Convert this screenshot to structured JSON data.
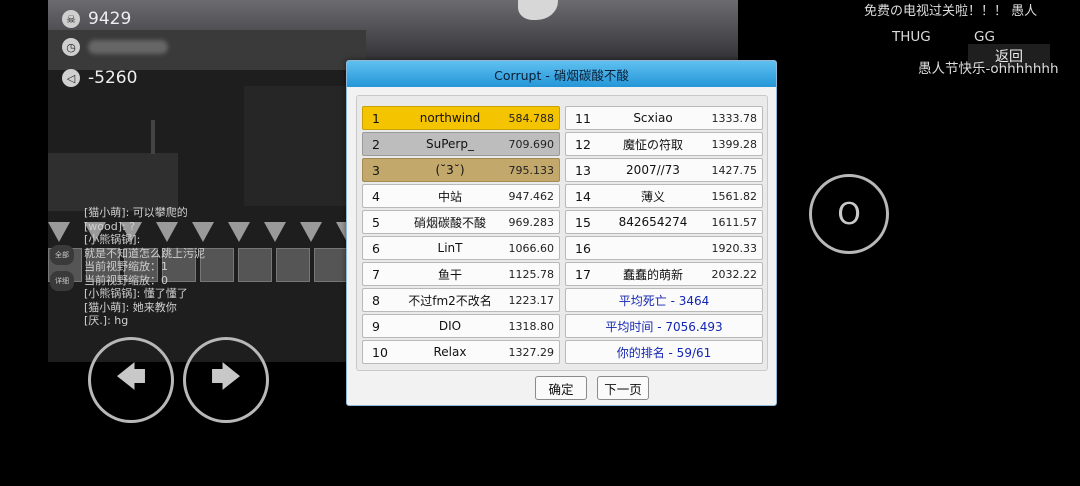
{
  "hud": {
    "deaths": "9429",
    "deaths_icon": "skull-icon",
    "time_icon": "clock-icon",
    "coords": "-5260",
    "coords_icon": "flag-icon"
  },
  "chat": [
    "[猫小萌]: 可以攀爬的",
    "[wood]: ?",
    "[小熊锅锅]:",
    "就是不知道怎么跳上污泥",
    "当前视野缩放：1",
    "当前视野缩放：0",
    "[小熊锅锅]: 懂了懂了",
    "[猫小萌]: 她来教你",
    "[厌.]: hg"
  ],
  "side_tags": {
    "all": "全部",
    "detail": "详细"
  },
  "controls": {
    "jump_label": "O",
    "left_icon": "arrow-left-icon",
    "right_icon": "arrow-right-icon"
  },
  "top_right": {
    "marquee": "免费の电视过关啦！！！       愚人",
    "player1": "THUG",
    "player2": "GG",
    "back_label": "返回",
    "announcement": "愚人节快乐-ohhhhhhh"
  },
  "dialog": {
    "title": "Corrupt - 硝烟碳酸不酸",
    "left_col": [
      {
        "rank": "1",
        "name": "northwind",
        "time": "584.788"
      },
      {
        "rank": "2",
        "name": "SuPerp_",
        "time": "709.690"
      },
      {
        "rank": "3",
        "name": "(˘3˘)",
        "time": "795.133"
      },
      {
        "rank": "4",
        "name": "中站",
        "time": "947.462"
      },
      {
        "rank": "5",
        "name": "硝烟碳酸不酸",
        "time": "969.283"
      },
      {
        "rank": "6",
        "name": "LinT",
        "time": "1066.60"
      },
      {
        "rank": "7",
        "name": "鱼干",
        "time": "1125.78"
      },
      {
        "rank": "8",
        "name": "不过fm2不改名",
        "time": "1223.17"
      },
      {
        "rank": "9",
        "name": "DIO",
        "time": "1318.80"
      },
      {
        "rank": "10",
        "name": "Relax",
        "time": "1327.29"
      }
    ],
    "right_col": [
      {
        "rank": "11",
        "name": "Scxiao",
        "time": "1333.78"
      },
      {
        "rank": "12",
        "name": "魔怔の符取",
        "time": "1399.28"
      },
      {
        "rank": "13",
        "name": "2007//73",
        "time": "1427.75"
      },
      {
        "rank": "14",
        "name": "薄义",
        "time": "1561.82"
      },
      {
        "rank": "15",
        "name": "842654274",
        "time": "1611.57"
      },
      {
        "rank": "16",
        "name": "",
        "time": "1920.33"
      },
      {
        "rank": "17",
        "name": "蠢蠢的萌新",
        "time": "2032.22"
      }
    ],
    "summary": {
      "avg_deaths": "平均死亡 - 3464",
      "avg_time": "平均时间 - 7056.493",
      "your_rank": "你的排名 - 59/61"
    },
    "confirm_label": "确定",
    "next_label": "下一页"
  }
}
